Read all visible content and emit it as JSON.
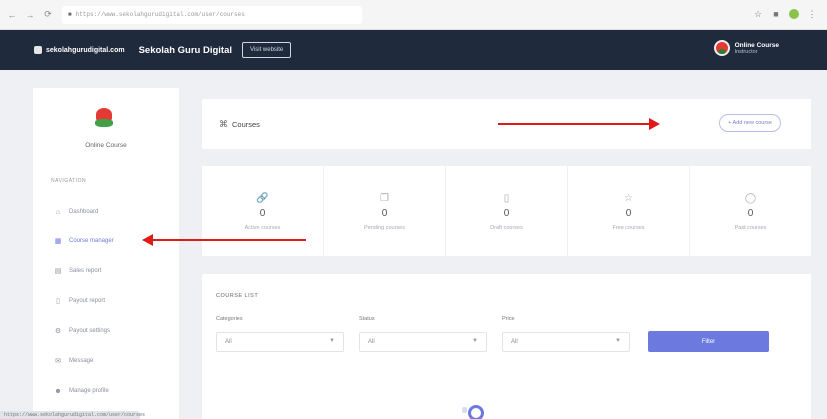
{
  "browser": {
    "url": "https://www.sekolahgurudigital.com/user/courses"
  },
  "header": {
    "domain": "sekolahgurudigital.com",
    "brand": "Sekolah Guru Digital",
    "visit_label": "Visit website",
    "user_name": "Online Course",
    "user_role": "Instructor"
  },
  "sidebar": {
    "title": "Online Course",
    "section": "NAVIGATION",
    "items": [
      {
        "label": "Dashboard",
        "icon": "home-icon"
      },
      {
        "label": "Course manager",
        "icon": "courses-icon"
      },
      {
        "label": "Sales report",
        "icon": "calendar-icon"
      },
      {
        "label": "Payout report",
        "icon": "clipboard-icon"
      },
      {
        "label": "Payout settings",
        "icon": "gear-icon"
      },
      {
        "label": "Message",
        "icon": "message-icon"
      },
      {
        "label": "Manage profile",
        "icon": "user-icon"
      }
    ]
  },
  "courses": {
    "title": "Courses",
    "add_label": "+ Add new course"
  },
  "stats": [
    {
      "value": "0",
      "label": "Active courses",
      "icon": "link-icon"
    },
    {
      "value": "0",
      "label": "Pending courses",
      "icon": "copy-icon"
    },
    {
      "value": "0",
      "label": "Draft courses",
      "icon": "draft-icon"
    },
    {
      "value": "0",
      "label": "Free courses",
      "icon": "star-icon"
    },
    {
      "value": "0",
      "label": "Paid courses",
      "icon": "tag-icon"
    }
  ],
  "course_list": {
    "title": "COURSE LIST",
    "filters": [
      {
        "label": "Categories",
        "value": "All"
      },
      {
        "label": "Status",
        "value": "All"
      },
      {
        "label": "Price",
        "value": "All"
      }
    ],
    "filter_label": "Filter"
  },
  "status_bar": {
    "url": "https://www.sekolahgurudigital.com/user/courses"
  },
  "colors": {
    "header_bg": "#1f2a3c",
    "accent": "#6c7ae0",
    "annotation_arrow": "#e01919"
  }
}
